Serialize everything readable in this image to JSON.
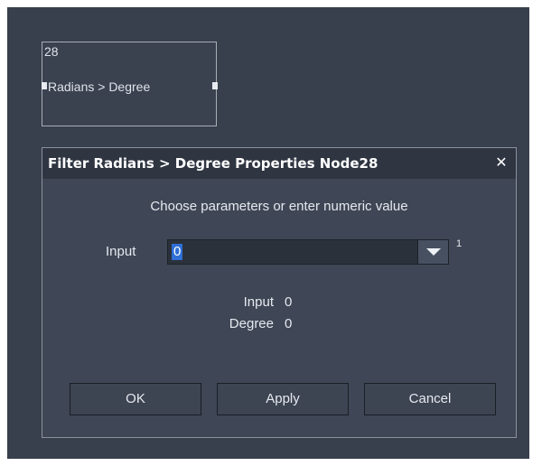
{
  "node": {
    "number": "28",
    "label": "Radians > Degree"
  },
  "dialog": {
    "title": "Filter Radians > Degree Properties Node28",
    "close_glyph": "✕",
    "instruction": "Choose parameters or enter numeric value",
    "input": {
      "label": "Input",
      "value": "0",
      "superscript": "1"
    },
    "readouts": [
      {
        "key": "Input",
        "value": "0"
      },
      {
        "key": "Degree",
        "value": "0"
      }
    ],
    "buttons": {
      "ok": "OK",
      "apply": "Apply",
      "cancel": "Cancel"
    }
  },
  "icons": {
    "close": "close-icon",
    "dropdown": "chevron-down-icon"
  },
  "colors": {
    "background": "#38404d",
    "dialog": "#3f4756",
    "titlebar": "#2f3642",
    "selection": "#2f6fd6"
  }
}
